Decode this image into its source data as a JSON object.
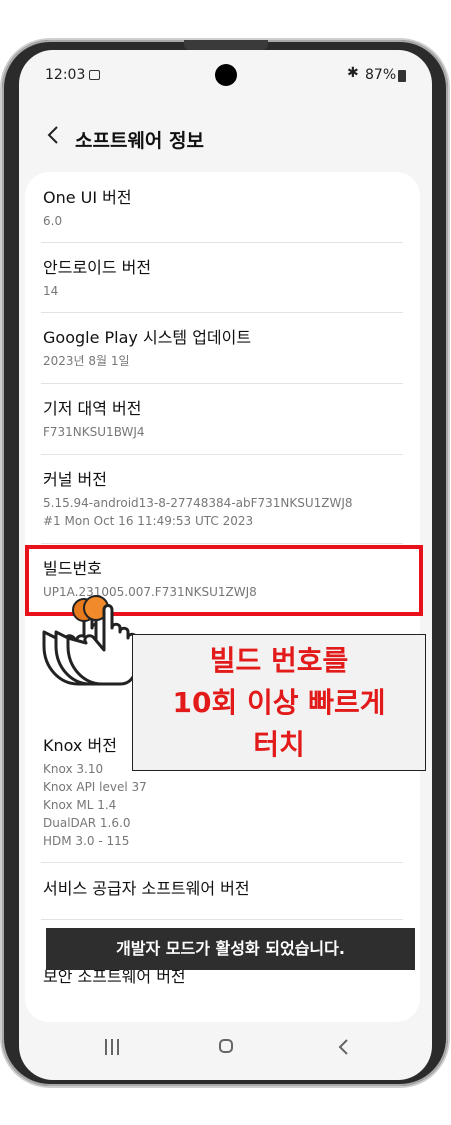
{
  "status_bar": {
    "time": "12:03",
    "battery": "87%"
  },
  "header": {
    "title": "소프트웨어 정보"
  },
  "items": [
    {
      "label": "One UI 버전",
      "sub": [
        "6.0"
      ]
    },
    {
      "label": "안드로이드 버전",
      "sub": [
        "14"
      ]
    },
    {
      "label": "Google Play 시스템 업데이트",
      "sub": [
        "2023년 8월 1일"
      ]
    },
    {
      "label": "기저 대역 버전",
      "sub": [
        "F731NKSU1BWJ4"
      ]
    },
    {
      "label": "커널 버전",
      "sub": [
        "5.15.94-android13-8-27748384-abF731NKSU1ZWJ8",
        "#1 Mon Oct 16 11:49:53 UTC 2023"
      ]
    },
    {
      "label": "빌드번호",
      "sub": [
        "UP1A.231005.007.F731NKSU1ZWJ8"
      ]
    },
    {
      "label": "Knox 버전",
      "sub": [
        "Knox 3.10",
        "Knox API level 37",
        "Knox ML 1.4",
        "DualDAR 1.6.0",
        "HDM 3.0 - 115"
      ]
    },
    {
      "label": "서비스 공급자 소프트웨어 버전",
      "sub": []
    },
    {
      "label": "보안 소프트웨어 버전",
      "sub": []
    }
  ],
  "callout": {
    "lines": [
      "빌드 번호를",
      "10회 이상 빠르게",
      "터치"
    ]
  },
  "toast": {
    "text": "개발자 모드가 활성화 되었습니다."
  },
  "colors": {
    "highlight": "#e8101a",
    "callout_text": "#e31a1a"
  },
  "icons": {
    "back": "chevron-left-icon",
    "bluetooth": "bluetooth-icon",
    "gallery": "gallery-icon",
    "hand": "tapping-hand-icon"
  }
}
